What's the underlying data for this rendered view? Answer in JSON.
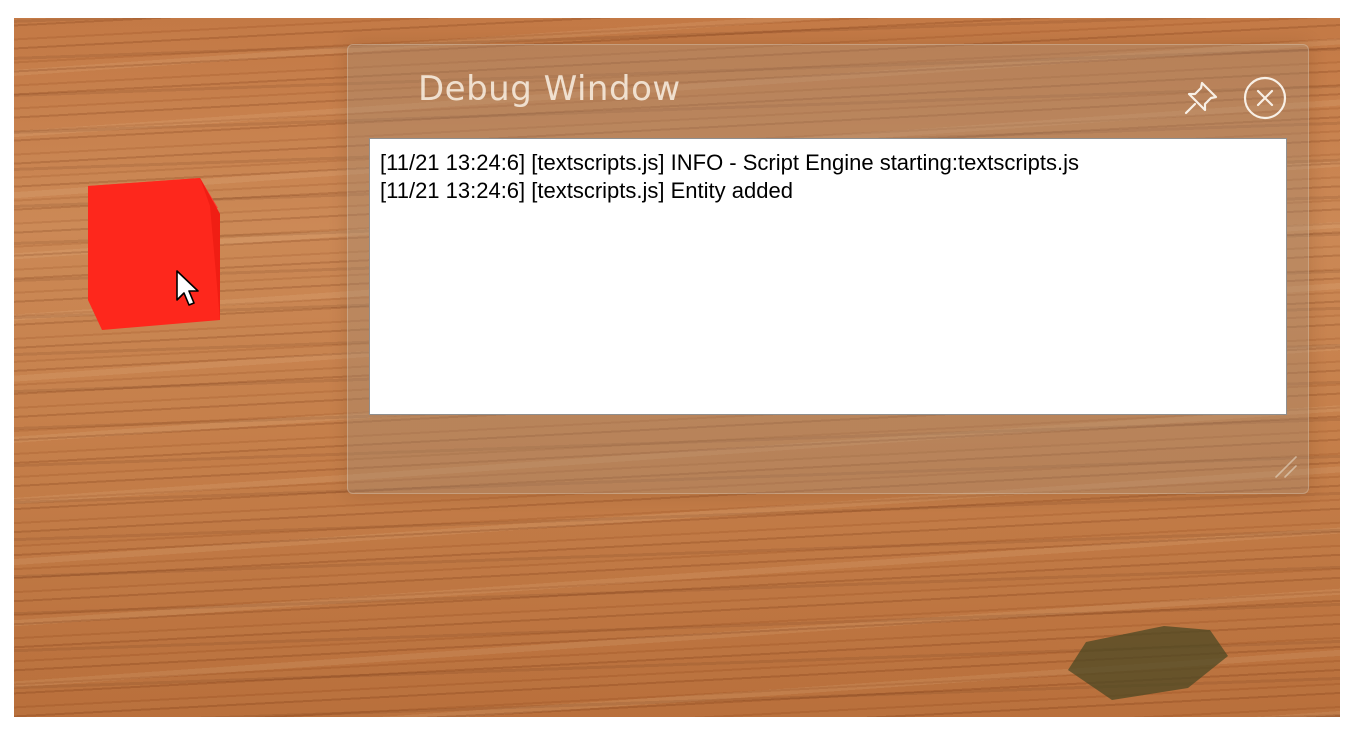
{
  "scene": {
    "floor": "wood-floor-texture",
    "objects": [
      {
        "kind": "cube",
        "color": "#ff2a1e"
      },
      {
        "kind": "shadow",
        "color": "#5a4a25"
      }
    ],
    "cursor": "arrow-pointer-icon"
  },
  "debug_window": {
    "title": "Debug Window",
    "pin_icon": "pin-icon",
    "close_icon": "close-circle-icon",
    "resize_icon": "resize-grip-icon",
    "log_lines": [
      "[11/21 13:24:6] [textscripts.js] INFO - Script Engine starting:textscripts.js",
      "[11/21 13:24:6] [textscripts.js] Entity added"
    ]
  },
  "colors": {
    "window_title": "#fdf8ef",
    "log_background": "#ffffff",
    "log_text": "#000000",
    "cube_front": "#ff2a1e"
  }
}
